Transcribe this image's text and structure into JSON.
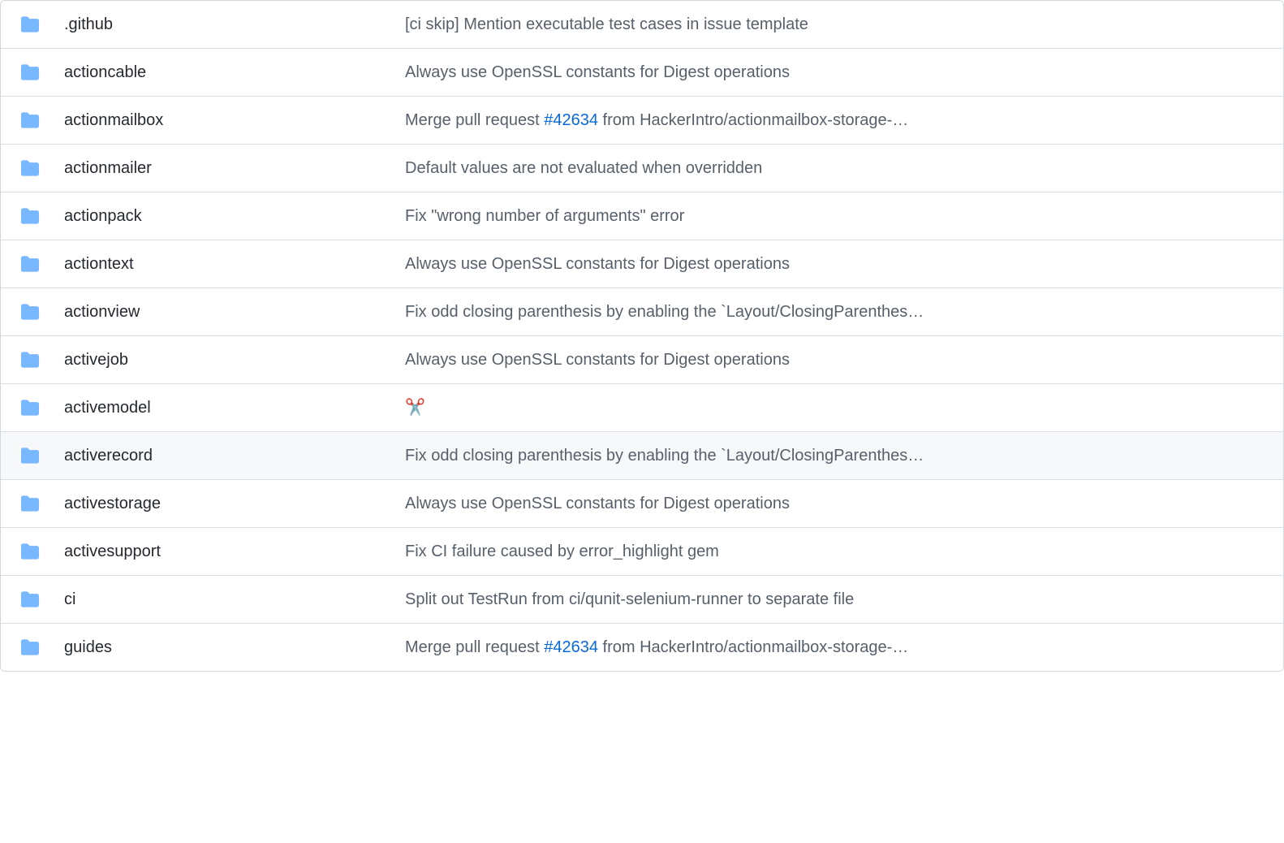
{
  "files": [
    {
      "name": ".github",
      "commit_prefix": "[ci skip] Mention executable test cases in issue template",
      "pr": "",
      "commit_suffix": ""
    },
    {
      "name": "actioncable",
      "commit_prefix": "Always use OpenSSL constants for Digest operations",
      "pr": "",
      "commit_suffix": ""
    },
    {
      "name": "actionmailbox",
      "commit_prefix": "Merge pull request ",
      "pr": "#42634",
      "commit_suffix": " from HackerIntro/actionmailbox-storage-…"
    },
    {
      "name": "actionmailer",
      "commit_prefix": "Default values are not evaluated when overridden",
      "pr": "",
      "commit_suffix": ""
    },
    {
      "name": "actionpack",
      "commit_prefix": "Fix \"wrong number of arguments\" error",
      "pr": "",
      "commit_suffix": ""
    },
    {
      "name": "actiontext",
      "commit_prefix": "Always use OpenSSL constants for Digest operations",
      "pr": "",
      "commit_suffix": ""
    },
    {
      "name": "actionview",
      "commit_prefix": "Fix odd closing parenthesis by enabling the `Layout/ClosingParenthes…",
      "pr": "",
      "commit_suffix": ""
    },
    {
      "name": "activejob",
      "commit_prefix": "Always use OpenSSL constants for Digest operations",
      "pr": "",
      "commit_suffix": ""
    },
    {
      "name": "activemodel",
      "commit_prefix": "✂️",
      "pr": "",
      "commit_suffix": ""
    },
    {
      "name": "activerecord",
      "commit_prefix": "Fix odd closing parenthesis by enabling the `Layout/ClosingParenthes…",
      "pr": "",
      "commit_suffix": "",
      "hovered": true
    },
    {
      "name": "activestorage",
      "commit_prefix": "Always use OpenSSL constants for Digest operations",
      "pr": "",
      "commit_suffix": ""
    },
    {
      "name": "activesupport",
      "commit_prefix": "Fix CI failure caused by error_highlight gem",
      "pr": "",
      "commit_suffix": ""
    },
    {
      "name": "ci",
      "commit_prefix": "Split out TestRun from ci/qunit-selenium-runner to separate file",
      "pr": "",
      "commit_suffix": ""
    },
    {
      "name": "guides",
      "commit_prefix": "Merge pull request ",
      "pr": "#42634",
      "commit_suffix": " from HackerIntro/actionmailbox-storage-…"
    }
  ]
}
